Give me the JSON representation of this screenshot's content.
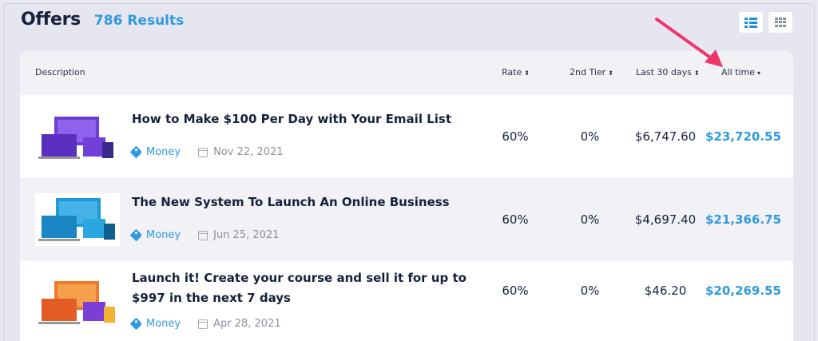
{
  "header": {
    "title": "Offers",
    "results": "786 Results"
  },
  "view_toggle": {
    "list_icon": "list-view-icon",
    "grid_icon": "grid-view-icon"
  },
  "colors": {
    "accent": "#2f9ae0",
    "title": "#16213b",
    "arrow": "#f0376b"
  },
  "table": {
    "columns": {
      "description": "Description",
      "rate": "Rate",
      "second_tier": "2nd Tier",
      "last30": "Last 30 days",
      "alltime": "All time"
    },
    "rows": [
      {
        "title": "How to Make $100 Per Day with Your Email List",
        "category": "Money",
        "date": "Nov 22, 2021",
        "rate": "60%",
        "second_tier": "0%",
        "last30": "$6,747.60",
        "alltime": "$23,720.55",
        "thumb_color": "#6b3fd6"
      },
      {
        "title": "The New System To Launch An Online Business",
        "category": "Money",
        "date": "Jun 25, 2021",
        "rate": "60%",
        "second_tier": "0%",
        "last30": "$4,697.40",
        "alltime": "$21,366.75",
        "thumb_color": "#1e9ad6"
      },
      {
        "title": "Launch it! Create your course and sell it for up to $997 in the next 7 days",
        "category": "Money",
        "date": "Apr 28, 2021",
        "rate": "60%",
        "second_tier": "0%",
        "last30": "$46.20",
        "alltime": "$20,269.55",
        "thumb_color": "#f07a2a"
      }
    ]
  }
}
